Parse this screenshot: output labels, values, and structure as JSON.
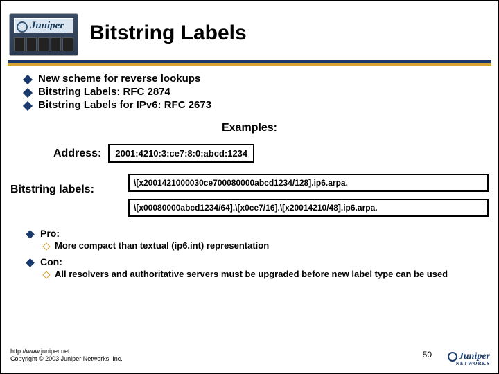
{
  "brand": "Juniper",
  "brand_sub": "NETWORKS",
  "title": "Bitstring Labels",
  "bullets": [
    "New scheme for reverse lookups",
    "Bitstring Labels: RFC 2874",
    "Bitstring Labels for IPv6: RFC 2673"
  ],
  "examples_label": "Examples:",
  "address_label": "Address:",
  "address_value": "2001:4210:3:ce7:8:0:abcd:1234",
  "bitstring_label": "Bitstring labels:",
  "bitstring_boxes": [
    "\\[x2001421000030ce700080000abcd1234/128].ip6.arpa.",
    "\\[x00080000abcd1234/64].\\[x0ce7/16].\\[x20014210/48].ip6.arpa."
  ],
  "pro_label": "Pro:",
  "pro_items": [
    "More compact than textual (ip6.int) representation"
  ],
  "con_label": "Con:",
  "con_items": [
    "All resolvers and authoritative servers must be upgraded before new label type can be used"
  ],
  "footer_url": "http://www.juniper.net",
  "footer_copyright": "Copyright © 2003 Juniper Networks, Inc.",
  "page_number": "50"
}
